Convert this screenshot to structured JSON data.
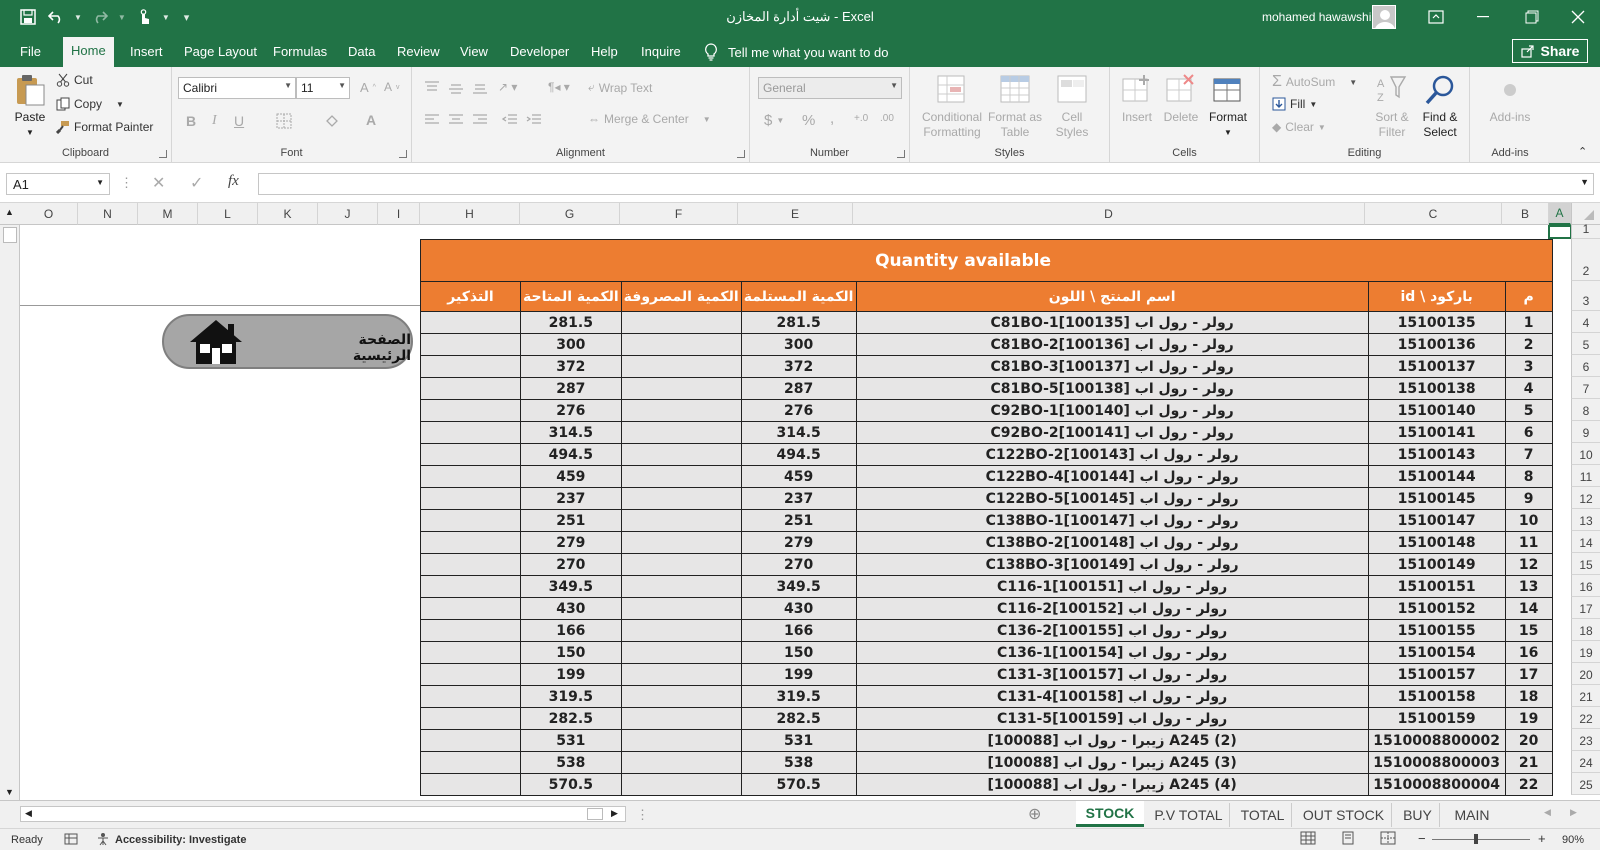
{
  "window": {
    "title": "شيت أدارة المخازن  -  Excel",
    "user": "mohamed hawawshi",
    "share_label": "Share"
  },
  "tabs": [
    "File",
    "Home",
    "Insert",
    "Page Layout",
    "Formulas",
    "Data",
    "Review",
    "View",
    "Developer",
    "Help",
    "Inquire"
  ],
  "tell_me": "Tell me what you want to do",
  "ribbon": {
    "clipboard": {
      "label": "Clipboard",
      "paste": "Paste",
      "cut": "Cut",
      "copy": "Copy",
      "format_painter": "Format Painter"
    },
    "font": {
      "label": "Font",
      "name": "Calibri",
      "size": "11"
    },
    "alignment": {
      "label": "Alignment",
      "wrap_text": "Wrap Text",
      "merge_center": "Merge & Center"
    },
    "number": {
      "label": "Number",
      "format": "General"
    },
    "styles": {
      "label": "Styles",
      "conditional": "Conditional Formatting",
      "format_table": "Format as Table",
      "cell_styles": "Cell Styles"
    },
    "cells": {
      "label": "Cells",
      "insert": "Insert",
      "delete": "Delete",
      "format": "Format"
    },
    "editing": {
      "label": "Editing",
      "autosum": "AutoSum",
      "fill": "Fill",
      "clear": "Clear",
      "sort_filter": "Sort & Filter",
      "find_select": "Find & Select"
    },
    "addins": {
      "label": "Add-ins",
      "addins": "Add-ins"
    }
  },
  "formula_bar": {
    "name_box": "A1",
    "formula": ""
  },
  "columns": [
    "O",
    "N",
    "M",
    "L",
    "K",
    "J",
    "I",
    "H",
    "G",
    "F",
    "E",
    "D",
    "C",
    "B",
    "A"
  ],
  "row_numbers": [
    "1",
    "2",
    "3",
    "4",
    "5",
    "6",
    "7",
    "8",
    "9",
    "10",
    "11",
    "12",
    "13",
    "14",
    "15",
    "16",
    "17",
    "18",
    "19",
    "20",
    "21",
    "22",
    "23",
    "24",
    "25"
  ],
  "sheet": {
    "title": "Quantity available",
    "headers": {
      "reminder": "التذكير",
      "available": "الكمية المتاحة",
      "spent": "الكمية المصروفة",
      "received": "الكمية المستلمة",
      "product": "اسم المنتج \\ اللون",
      "barcode": "باركود \\ id",
      "num": "م"
    },
    "rows": [
      {
        "n": "1",
        "barcode": "15100135",
        "product": "رولر - رول اب [100135]C81BO-1",
        "received": "281.5",
        "spent": "",
        "available": "281.5"
      },
      {
        "n": "2",
        "barcode": "15100136",
        "product": "رولر - رول اب [100136]C81BO-2",
        "received": "300",
        "spent": "",
        "available": "300"
      },
      {
        "n": "3",
        "barcode": "15100137",
        "product": "رولر - رول اب [100137]C81BO-3",
        "received": "372",
        "spent": "",
        "available": "372"
      },
      {
        "n": "4",
        "barcode": "15100138",
        "product": "رولر - رول اب [100138]C81BO-5",
        "received": "287",
        "spent": "",
        "available": "287"
      },
      {
        "n": "5",
        "barcode": "15100140",
        "product": "رولر - رول اب [100140]C92BO-1",
        "received": "276",
        "spent": "",
        "available": "276"
      },
      {
        "n": "6",
        "barcode": "15100141",
        "product": "رولر - رول اب [100141]C92BO-2",
        "received": "314.5",
        "spent": "",
        "available": "314.5"
      },
      {
        "n": "7",
        "barcode": "15100143",
        "product": "رولر - رول اب [100143]C122BO-2",
        "received": "494.5",
        "spent": "",
        "available": "494.5"
      },
      {
        "n": "8",
        "barcode": "15100144",
        "product": "رولر - رول اب [100144]C122BO-4",
        "received": "459",
        "spent": "",
        "available": "459"
      },
      {
        "n": "9",
        "barcode": "15100145",
        "product": "رولر - رول اب [100145]C122BO-5",
        "received": "237",
        "spent": "",
        "available": "237"
      },
      {
        "n": "10",
        "barcode": "15100147",
        "product": "رولر - رول اب [100147]C138BO-1",
        "received": "251",
        "spent": "",
        "available": "251"
      },
      {
        "n": "11",
        "barcode": "15100148",
        "product": "رولر - رول اب [100148]C138BO-2",
        "received": "279",
        "spent": "",
        "available": "279"
      },
      {
        "n": "12",
        "barcode": "15100149",
        "product": "رولر - رول اب [100149]C138BO-3",
        "received": "270",
        "spent": "",
        "available": "270"
      },
      {
        "n": "13",
        "barcode": "15100151",
        "product": "رولر - رول اب [100151]C116-1",
        "received": "349.5",
        "spent": "",
        "available": "349.5"
      },
      {
        "n": "14",
        "barcode": "15100152",
        "product": "رولر - رول اب [100152]C116-2",
        "received": "430",
        "spent": "",
        "available": "430"
      },
      {
        "n": "15",
        "barcode": "15100155",
        "product": "رولر - رول اب [100155]C136-2",
        "received": "166",
        "spent": "",
        "available": "166"
      },
      {
        "n": "16",
        "barcode": "15100154",
        "product": "رولر - رول اب [100154]C136-1",
        "received": "150",
        "spent": "",
        "available": "150"
      },
      {
        "n": "17",
        "barcode": "15100157",
        "product": "رولر - رول اب [100157]C131-3",
        "received": "199",
        "spent": "",
        "available": "199"
      },
      {
        "n": "18",
        "barcode": "15100158",
        "product": "رولر - رول اب [100158]C131-4",
        "received": "319.5",
        "spent": "",
        "available": "319.5"
      },
      {
        "n": "19",
        "barcode": "15100159",
        "product": "رولر - رول اب [100159]C131-5",
        "received": "282.5",
        "spent": "",
        "available": "282.5"
      },
      {
        "n": "20",
        "barcode": "1510008800002",
        "product": "A245 (2) زيبرا - رول اب [100088]",
        "received": "531",
        "spent": "",
        "available": "531"
      },
      {
        "n": "21",
        "barcode": "1510008800003",
        "product": "A245 (3) زيبرا - رول اب [100088]",
        "received": "538",
        "spent": "",
        "available": "538"
      },
      {
        "n": "22",
        "barcode": "1510008800004",
        "product": "A245 (4) زيبرا - رول اب [100088]",
        "received": "570.5",
        "spent": "",
        "available": "570.5"
      }
    ],
    "home_button": "الصفحة الرئيسية"
  },
  "sheet_tabs": [
    "STOCK",
    "P.V TOTAL",
    "TOTAL",
    "OUT STOCK",
    "BUY",
    "MAIN"
  ],
  "status": {
    "ready": "Ready",
    "accessibility": "Accessibility: Investigate",
    "zoom": "90%"
  },
  "colors": {
    "excel_green": "#217346",
    "orange_header": "#ed7d31",
    "row_fill": "#e7e6e6"
  }
}
